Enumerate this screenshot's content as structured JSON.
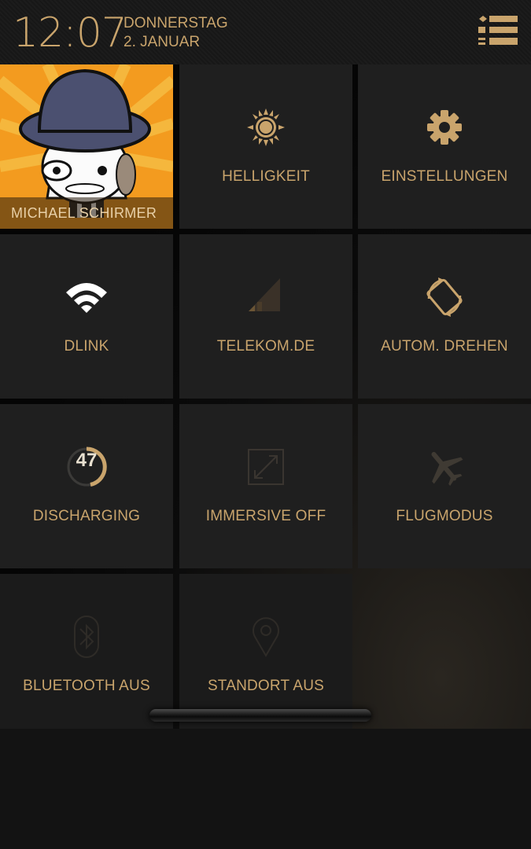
{
  "header": {
    "time": "12:07",
    "weekday": "DONNERSTAG",
    "date": "2. JANUAR"
  },
  "profile": {
    "name": "MICHAEL SCHIRMER"
  },
  "tiles": [
    {
      "label": "HELLIGKEIT",
      "icon": "brightness-icon"
    },
    {
      "label": "EINSTELLUNGEN",
      "icon": "gear-icon"
    },
    {
      "label": "DLINK",
      "icon": "wifi-icon"
    },
    {
      "label": "TELEKOM.DE",
      "icon": "cell-signal-icon"
    },
    {
      "label": "AUTOM. DREHEN",
      "icon": "auto-rotate-icon"
    },
    {
      "label": "DISCHARGING",
      "icon": "battery-icon",
      "value": "47"
    },
    {
      "label": "IMMERSIVE OFF",
      "icon": "immersive-icon"
    },
    {
      "label": "FLUGMODUS",
      "icon": "airplane-icon"
    },
    {
      "label": "BLUETOOTH AUS",
      "icon": "bluetooth-icon"
    },
    {
      "label": "STANDORT AUS",
      "icon": "location-icon"
    }
  ],
  "colors": {
    "accent": "#c9a46c",
    "tile": "#1f1f1f",
    "background": "#121212"
  }
}
